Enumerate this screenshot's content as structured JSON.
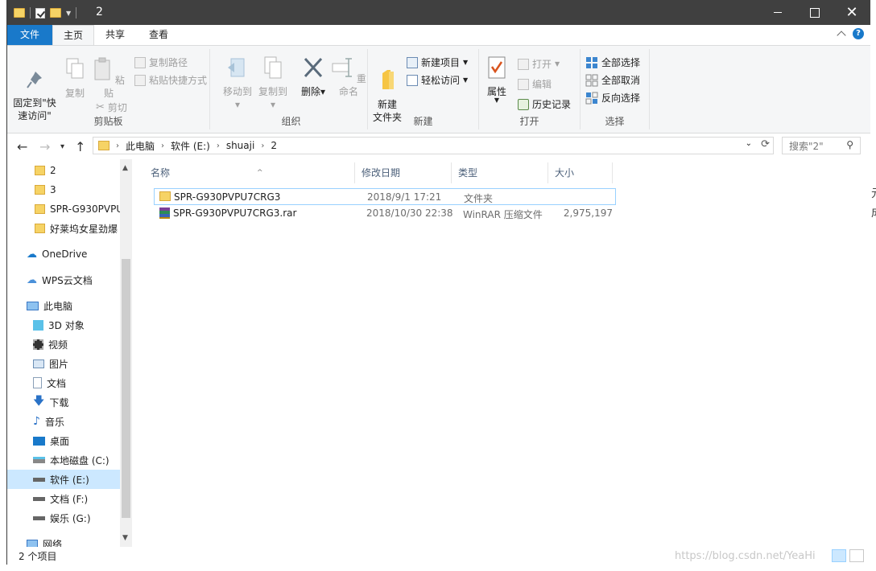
{
  "window": {
    "title": "2"
  },
  "tabs": {
    "file": "文件",
    "home": "主页",
    "share": "共享",
    "view": "查看"
  },
  "ribbon": {
    "clipboard": {
      "label": "剪贴板",
      "pin": "固定到\"快\n速访问\"",
      "copy": "复制",
      "paste": "粘贴",
      "copy_path": "复制路径",
      "paste_shortcut": "粘贴快捷方式",
      "cut": "剪切"
    },
    "organize": {
      "label": "组织",
      "move_to": "移动到",
      "copy_to": "复制到",
      "delete": "删除",
      "rename": "重命名"
    },
    "new": {
      "label": "新建",
      "new_folder": "新建\n文件夹",
      "new_item": "新建项目",
      "easy_access": "轻松访问"
    },
    "open": {
      "label": "打开",
      "properties": "属性",
      "open": "打开",
      "edit": "编辑",
      "history": "历史记录"
    },
    "select": {
      "label": "选择",
      "select_all": "全部选择",
      "select_none": "全部取消",
      "invert": "反向选择"
    }
  },
  "address": {
    "crumbs": [
      "此电脑",
      "软件 (E:)",
      "shuaji",
      "2"
    ],
    "search_placeholder": "搜索\"2\""
  },
  "nav": [
    {
      "label": "2",
      "icon": "folder"
    },
    {
      "label": "3",
      "icon": "folder"
    },
    {
      "label": "SPR-G930PVPU",
      "icon": "folder"
    },
    {
      "label": "好莱坞女星劲爆",
      "icon": "folder"
    },
    {
      "label": "OneDrive",
      "icon": "cloud"
    },
    {
      "label": "WPS云文档",
      "icon": "cloud-outline"
    },
    {
      "label": "此电脑",
      "icon": "computer"
    },
    {
      "label": "3D 对象",
      "icon": "cube"
    },
    {
      "label": "视频",
      "icon": "film"
    },
    {
      "label": "图片",
      "icon": "picture"
    },
    {
      "label": "文档",
      "icon": "document"
    },
    {
      "label": "下载",
      "icon": "download"
    },
    {
      "label": "音乐",
      "icon": "music"
    },
    {
      "label": "桌面",
      "icon": "desktop"
    },
    {
      "label": "本地磁盘 (C:)",
      "icon": "drive-c"
    },
    {
      "label": "软件 (E:)",
      "icon": "drive"
    },
    {
      "label": "文档 (F:)",
      "icon": "drive"
    },
    {
      "label": "娱乐 (G:)",
      "icon": "drive"
    },
    {
      "label": "网络",
      "icon": "network"
    }
  ],
  "columns": {
    "name": "名称",
    "date": "修改日期",
    "type": "类型",
    "size": "大小"
  },
  "files": [
    {
      "name": "SPR-G930PVPU7CRG3",
      "date": "2018/9/1 17:21",
      "type": "文件夹",
      "size": ""
    },
    {
      "name": "SPR-G930PVPU7CRG3.rar",
      "date": "2018/10/30 22:38",
      "type": "WinRAR 压缩文件",
      "size": "2,975,197"
    }
  ],
  "status": {
    "count": "2 个项目"
  },
  "watermark": "https://blog.csdn.net/YeaHi",
  "colors": {
    "accent": "#1979ca",
    "selection": "#cce8ff",
    "titlebar": "#404040"
  }
}
